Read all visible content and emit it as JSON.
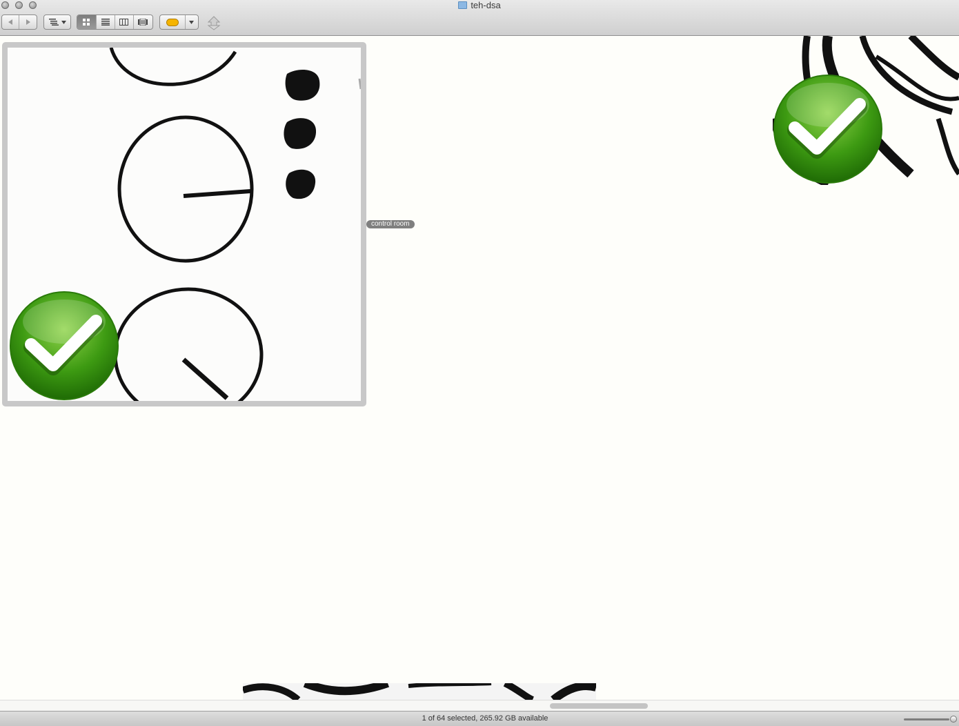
{
  "window": {
    "title": "teh-dsa"
  },
  "toolbar": {
    "back_icon": "back-arrow-icon",
    "forward_icon": "forward-arrow-icon",
    "arrange_icon": "arrange-list-icon",
    "view_modes": [
      "icon-view-icon",
      "list-view-icon",
      "column-view-icon",
      "coverflow-view-icon"
    ],
    "label_color": "#f5b400",
    "share_icon": "share-icon"
  },
  "items": {
    "selected_name": "control room"
  },
  "status": {
    "text": "1 of 64 selected, 265.92 GB available"
  },
  "colors": {
    "check_green": "#3d9a12",
    "selection_gray": "#c8c8c8",
    "label_gray": "#7f7f7f"
  }
}
